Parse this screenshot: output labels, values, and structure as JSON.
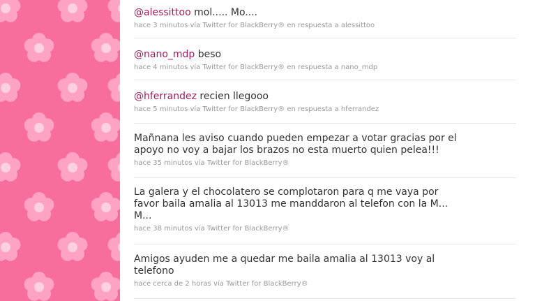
{
  "theme": {
    "background_color": "#f76d9c",
    "flower_color": "#ffa3c4",
    "flower_center_color": "#ffd0e1",
    "mention_color": "#a11d5f",
    "text_color": "#333333",
    "meta_color": "#999999"
  },
  "tweets": [
    {
      "mention": "@alessittoo",
      "text": " mol..... Mo....",
      "lines": [],
      "time": "hace 3 minutos",
      "via": "vía Twitter for BlackBerry®",
      "reply": "en respuesta a alessittoo"
    },
    {
      "mention": "@nano_mdp",
      "text": " beso",
      "lines": [],
      "time": "hace 4 minutos",
      "via": "vía Twitter for BlackBerry®",
      "reply": "en respuesta a nano_mdp"
    },
    {
      "mention": "@hferrandez",
      "text": " recien llegooo",
      "lines": [],
      "time": "hace 5 minutos",
      "via": "vía Twitter for BlackBerry®",
      "reply": "en respuesta a hferrandez"
    },
    {
      "mention": "",
      "text": "",
      "lines": [
        "Mañnana les aviso cuando pueden empezar a votar gracias por el",
        "apoyo no voy a bajar los brazos no esta muerto quien pelea!!!"
      ],
      "time": "hace 35 minutos",
      "via": "vía Twitter for BlackBerry®",
      "reply": ""
    },
    {
      "mention": "",
      "text": "",
      "lines": [
        "La galera y el chocolatero se complotaron para q me vaya por",
        "favor baila amalia al 13013 me manddaron al telefon con la M...",
        "M..."
      ],
      "time": "hace 38 minutos",
      "via": "vía Twitter for BlackBerry®",
      "reply": ""
    },
    {
      "mention": "",
      "text": "",
      "lines": [
        "Amigos ayuden me a quedar me baila amalia al 13013 voy al",
        "telefono"
      ],
      "time": "hace cerca de 2 horas",
      "via": "vía Twitter for BlackBerry®",
      "reply": ""
    }
  ]
}
